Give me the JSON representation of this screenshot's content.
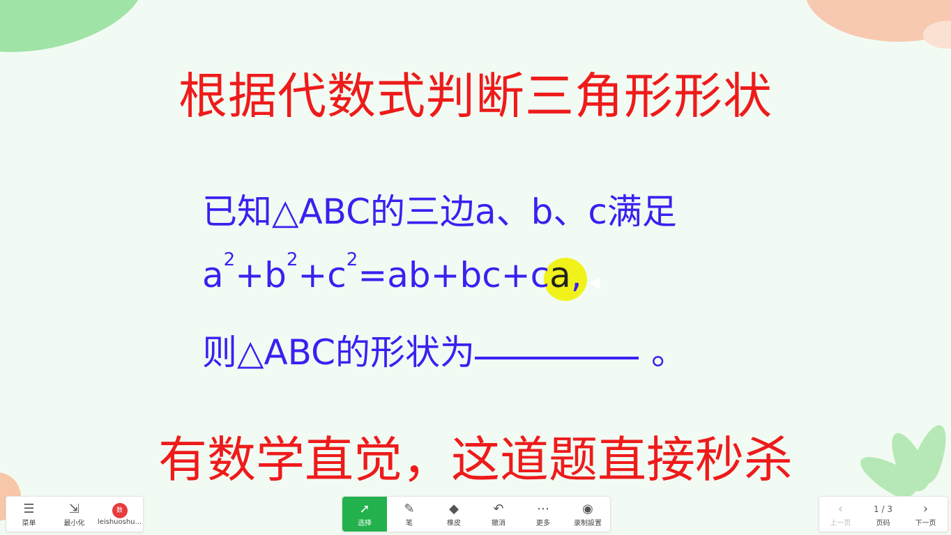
{
  "slide": {
    "title": "根据代数式判断三角形形状",
    "line1": "已知△ABC的三边a、b、c满足",
    "line2": {
      "a": "a",
      "b": "b",
      "c": "c",
      "exp": "2",
      "plus": "+",
      "eq": "=",
      "rhs_start": "ab+bc+c",
      "rhs_highlight": "a",
      "comma": ","
    },
    "line3_prefix": "则△ABC的形状为",
    "line3_suffix": "。",
    "subtitle": "有数学直觉，这道题直接秒杀"
  },
  "toolbar_left": {
    "menu": {
      "label": "菜单",
      "icon": "menu-icon"
    },
    "minimize": {
      "label": "最小化",
      "icon": "minimize-icon"
    },
    "account": {
      "label": "leishuoshu...",
      "icon": "account-logo",
      "logo_text": "数"
    }
  },
  "toolbar_mid": {
    "select": {
      "label": "选择",
      "icon": "cursor-icon"
    },
    "pen": {
      "label": "笔",
      "icon": "pen-icon"
    },
    "eraser": {
      "label": "橡皮",
      "icon": "eraser-icon"
    },
    "undo": {
      "label": "撤消",
      "icon": "undo-icon"
    },
    "more": {
      "label": "更多",
      "icon": "more-icon"
    },
    "record": {
      "label": "录制設置",
      "icon": "record-icon"
    }
  },
  "toolbar_right": {
    "prev": {
      "label": "上一页",
      "icon": "chevron-left-icon"
    },
    "page": {
      "label": "页码",
      "value": "1 / 3"
    },
    "next": {
      "label": "下一页",
      "icon": "chevron-right-icon"
    }
  },
  "colors": {
    "title": "#ee1b1b",
    "body": "#3b20f0",
    "accent": "#22b14c",
    "highlight": "#f1f21a"
  }
}
